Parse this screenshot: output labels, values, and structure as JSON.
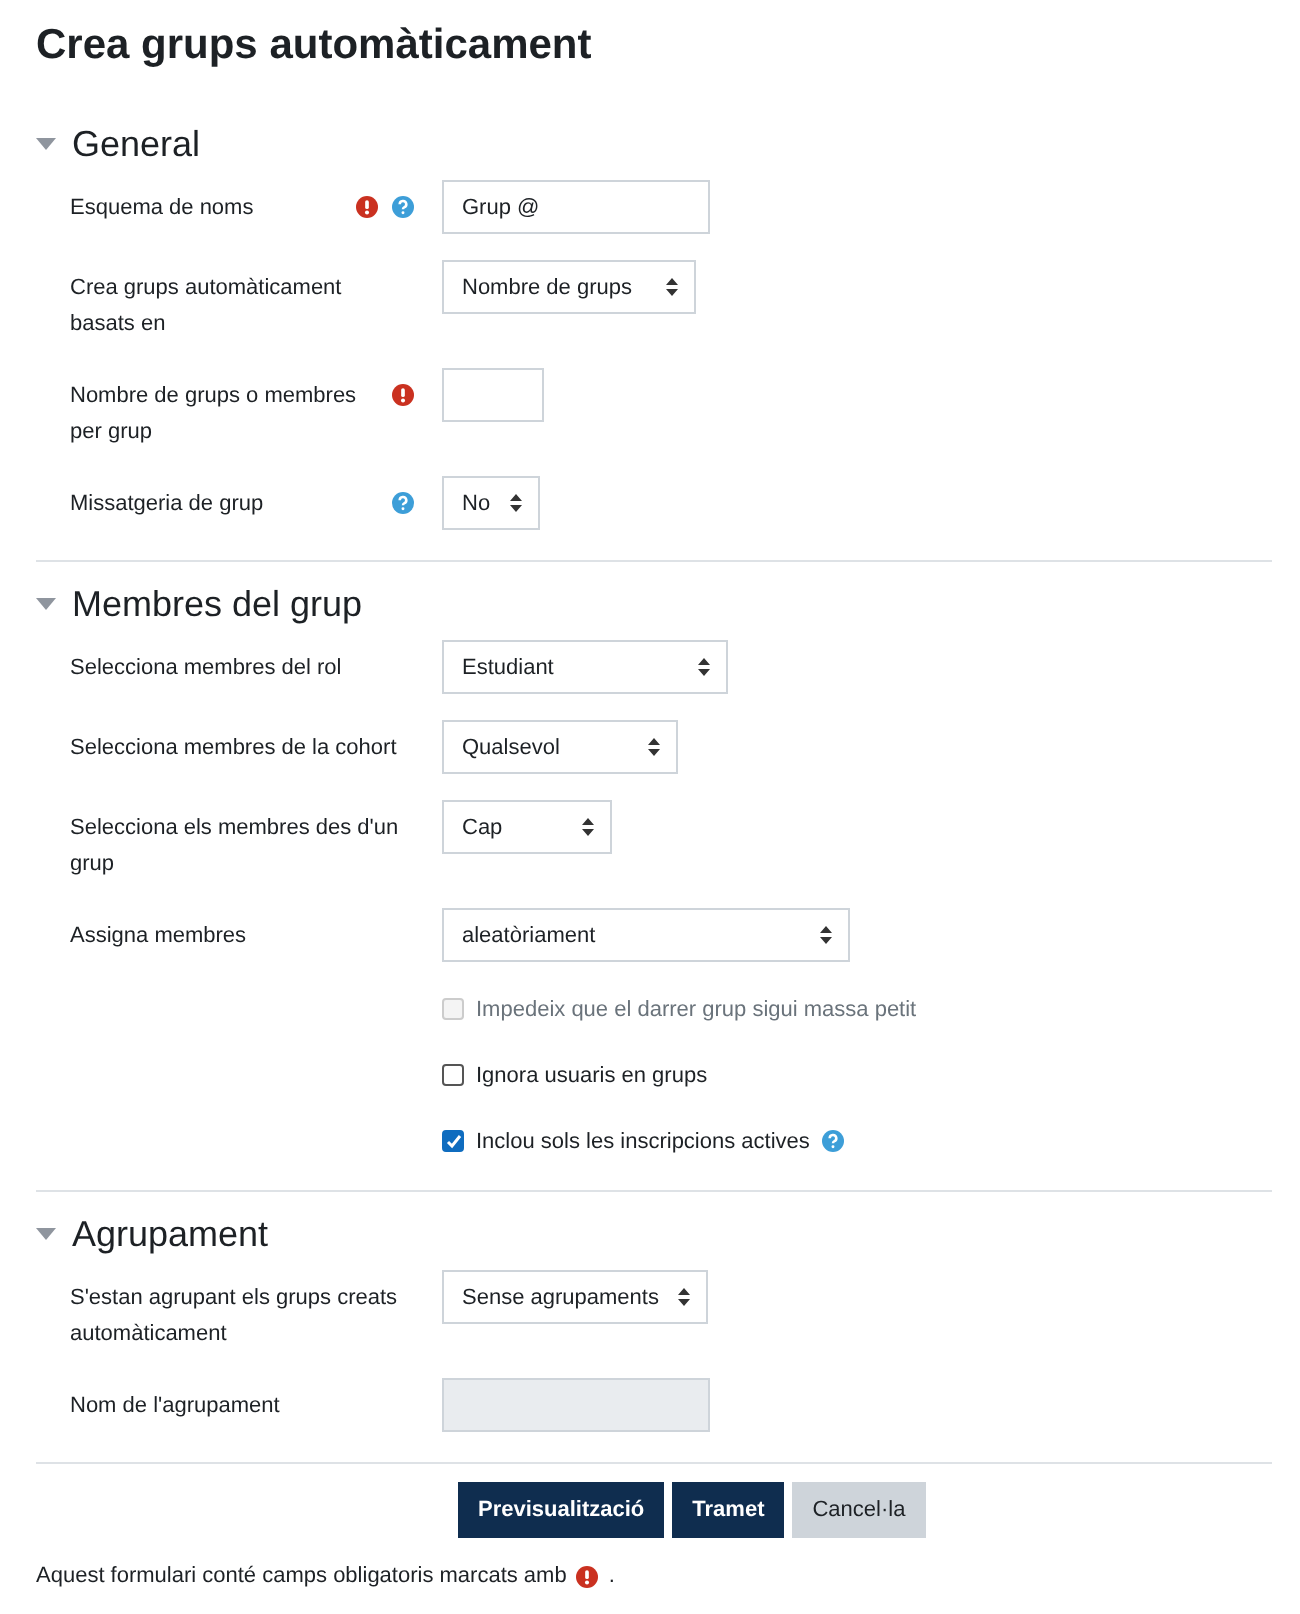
{
  "title": "Crea grups automàticament",
  "sections": [
    {
      "title": "General",
      "expanded": true,
      "fields": [
        {
          "kind": "text",
          "label": "Esquema de noms",
          "required": true,
          "help": true,
          "value": "Grup @",
          "disabled": false
        },
        {
          "kind": "select",
          "label": "Crea grups automàticament basats en",
          "required": false,
          "help": false,
          "value": "Nombre de grups"
        },
        {
          "kind": "text",
          "label": "Nombre de grups o membres per grup",
          "required": true,
          "help": false,
          "disabled": false
        },
        {
          "kind": "select",
          "label": "Missatgeria de grup",
          "required": false,
          "help": true,
          "value": "No"
        }
      ]
    },
    {
      "title": "Membres del grup",
      "expanded": true,
      "fields": [
        {
          "kind": "select",
          "label": "Selecciona membres del rol",
          "required": false,
          "help": false,
          "value": "Estudiant"
        },
        {
          "kind": "select",
          "label": "Selecciona membres de la cohort",
          "required": false,
          "help": false,
          "value": "Qualsevol"
        },
        {
          "kind": "select",
          "label": "Selecciona els membres des d'un grup",
          "required": false,
          "help": false,
          "value": "Cap"
        },
        {
          "kind": "select",
          "label": "Assigna membres",
          "required": false,
          "help": false,
          "value": "aleatòriament"
        },
        {
          "kind": "checkbox",
          "label": "Impedeix que el darrer grup sigui massa petit",
          "checked": false,
          "disabled": true,
          "help": false
        },
        {
          "kind": "checkbox",
          "label": "Ignora usuaris en grups",
          "checked": false,
          "disabled": false,
          "help": false
        },
        {
          "kind": "checkbox",
          "label": "Inclou sols les inscripcions actives",
          "checked": true,
          "disabled": false,
          "help": true
        }
      ]
    },
    {
      "title": "Agrupament",
      "expanded": true,
      "fields": [
        {
          "kind": "select",
          "label": "S'estan agrupant els grups creats automàticament",
          "required": false,
          "help": false,
          "value": "Sense agrupaments"
        },
        {
          "kind": "text",
          "label": "Nom de l'agrupament",
          "required": false,
          "help": false,
          "disabled": true
        }
      ]
    }
  ],
  "buttons": [
    {
      "label": "Previsualització",
      "kind": "primary"
    },
    {
      "label": "Tramet",
      "kind": "primary"
    },
    {
      "label": "Cancel·la",
      "kind": "secondary"
    }
  ],
  "footer": {
    "text": "Aquest formulari conté camps obligatoris marcats amb",
    "suffix": "."
  }
}
